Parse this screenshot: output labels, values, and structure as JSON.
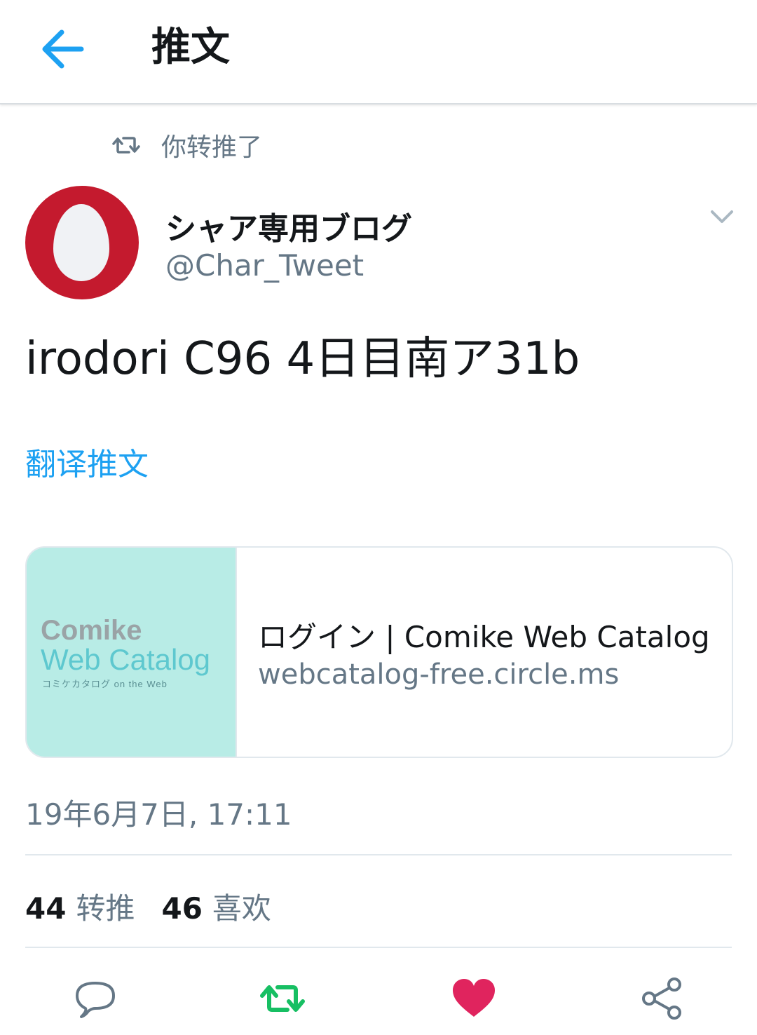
{
  "header": {
    "title": "推文",
    "back_icon": "arrow-left-icon"
  },
  "retweet_context": {
    "text": "你转推了",
    "icon": "retweet-icon"
  },
  "tweet": {
    "author": {
      "display_name": "シャア専用ブログ",
      "handle": "@Char_Tweet"
    },
    "text": "irodori C96 4日目南ア31b",
    "translate_label": "翻译推文",
    "timestamp": "19年6月7日, 17:11"
  },
  "card": {
    "thumbnail_logo": {
      "line1": "Comike",
      "line2": "Web Catalog",
      "line3": "コミケカタログ on the Web"
    },
    "title": "ログイン | Comike Web Catalog",
    "domain": "webcatalog-free.circle.ms"
  },
  "stats": {
    "retweets": {
      "count": "44",
      "label": "转推"
    },
    "likes": {
      "count": "46",
      "label": "喜欢"
    }
  },
  "actions": {
    "reply_icon": "reply-icon",
    "retweet_icon": "retweet-icon",
    "like_icon": "heart-icon",
    "share_icon": "share-icon"
  },
  "colors": {
    "accent": "#1da1f2",
    "retweet_active": "#17bf63",
    "like_active": "#e0245e",
    "secondary_text": "#657786",
    "avatar_red": "#c41a2e",
    "card_thumb_bg": "#b8ece6"
  }
}
